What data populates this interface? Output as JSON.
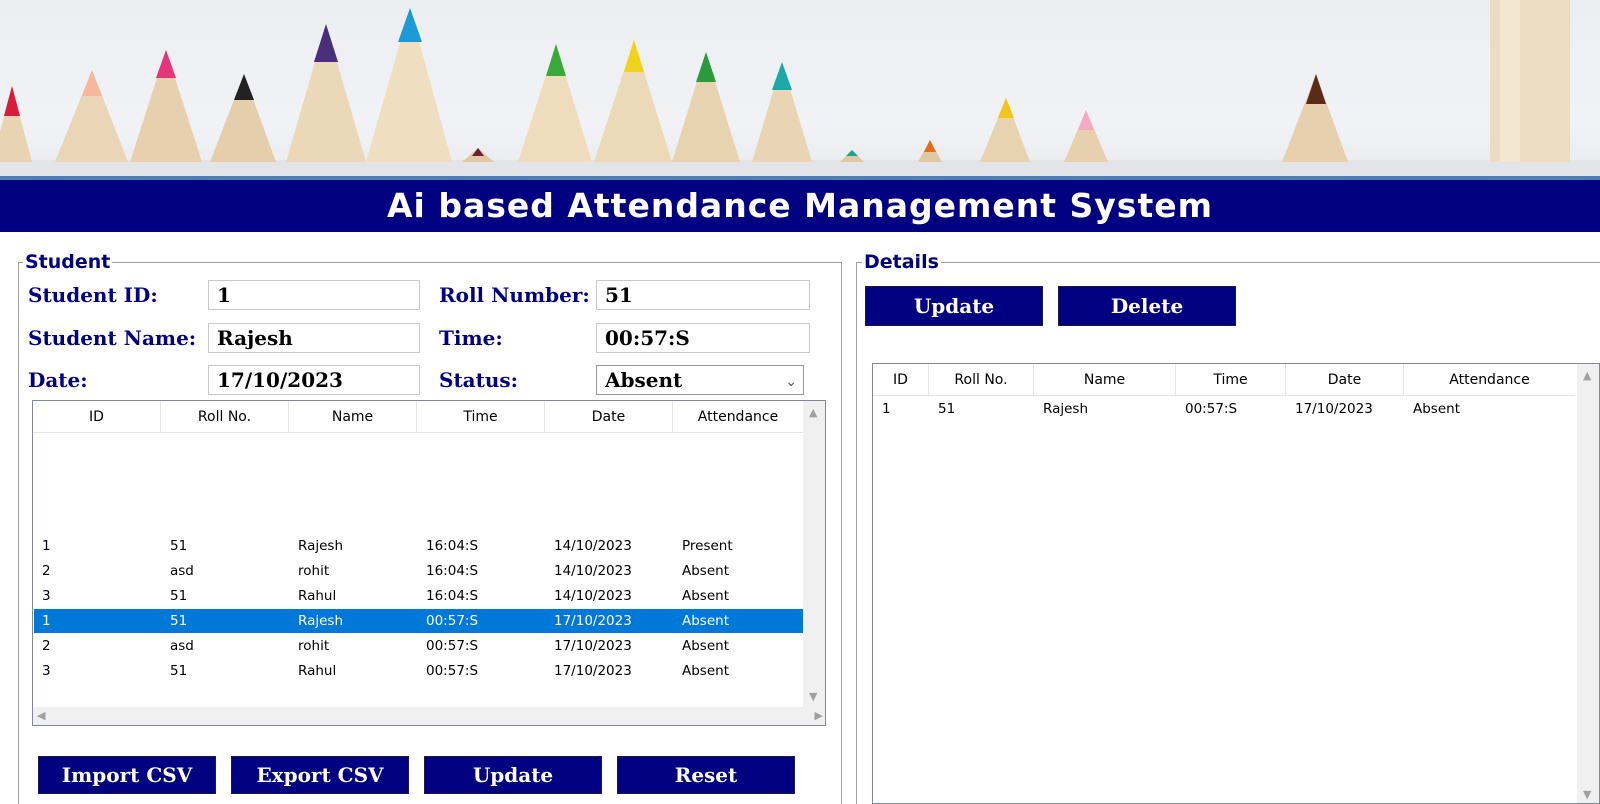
{
  "app": {
    "title": "Ai based Attendance Management System"
  },
  "student_frame": {
    "legend": "Student",
    "fields": {
      "student_id_label": "Student ID:",
      "student_id_value": "1",
      "roll_number_label": "Roll Number:",
      "roll_number_value": "51",
      "student_name_label": "Student Name:",
      "student_name_value": "Rajesh",
      "time_label": "Time:",
      "time_value": "00:57:S",
      "date_label": "Date:",
      "date_value": "17/10/2023",
      "status_label": "Status:",
      "status_value": "Absent"
    },
    "table": {
      "columns": [
        "ID",
        "Roll No.",
        "Name",
        "Time",
        "Date",
        "Attendance"
      ],
      "rows": [
        [
          "1",
          "51",
          "Rajesh",
          "16:04:S",
          "14/10/2023",
          "Present"
        ],
        [
          "2",
          "asd",
          "rohit",
          "16:04:S",
          "14/10/2023",
          "Absent"
        ],
        [
          "3",
          "51",
          "Rahul",
          "16:04:S",
          "14/10/2023",
          "Absent"
        ],
        [
          "1",
          "51",
          "Rajesh",
          "00:57:S",
          "17/10/2023",
          "Absent"
        ],
        [
          "2",
          "asd",
          "rohit",
          "00:57:S",
          "17/10/2023",
          "Absent"
        ],
        [
          "3",
          "51",
          "Rahul",
          "00:57:S",
          "17/10/2023",
          "Absent"
        ]
      ],
      "selected_row": 3
    },
    "buttons": {
      "import_csv": "Import CSV",
      "export_csv": "Export CSV",
      "update": "Update",
      "reset": "Reset"
    }
  },
  "details_frame": {
    "legend": "Details",
    "buttons": {
      "update": "Update",
      "delete": "Delete"
    },
    "table": {
      "columns": [
        "ID",
        "Roll No.",
        "Name",
        "Time",
        "Date",
        "Attendance"
      ],
      "rows": [
        [
          "1",
          "51",
          "Rajesh",
          "00:57:S",
          "17/10/2023",
          "Absent"
        ]
      ]
    }
  },
  "colors": {
    "accent": "#000080",
    "selection": "#0078d7"
  }
}
